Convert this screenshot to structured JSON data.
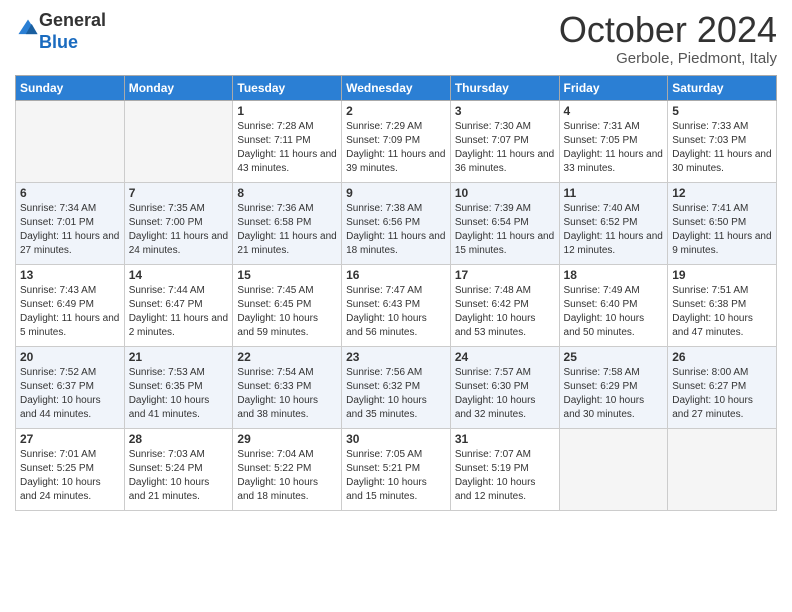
{
  "logo": {
    "general": "General",
    "blue": "Blue"
  },
  "header": {
    "month": "October 2024",
    "location": "Gerbole, Piedmont, Italy"
  },
  "weekdays": [
    "Sunday",
    "Monday",
    "Tuesday",
    "Wednesday",
    "Thursday",
    "Friday",
    "Saturday"
  ],
  "weeks": [
    [
      {
        "day": "",
        "info": ""
      },
      {
        "day": "",
        "info": ""
      },
      {
        "day": "1",
        "info": "Sunrise: 7:28 AM\nSunset: 7:11 PM\nDaylight: 11 hours and 43 minutes."
      },
      {
        "day": "2",
        "info": "Sunrise: 7:29 AM\nSunset: 7:09 PM\nDaylight: 11 hours and 39 minutes."
      },
      {
        "day": "3",
        "info": "Sunrise: 7:30 AM\nSunset: 7:07 PM\nDaylight: 11 hours and 36 minutes."
      },
      {
        "day": "4",
        "info": "Sunrise: 7:31 AM\nSunset: 7:05 PM\nDaylight: 11 hours and 33 minutes."
      },
      {
        "day": "5",
        "info": "Sunrise: 7:33 AM\nSunset: 7:03 PM\nDaylight: 11 hours and 30 minutes."
      }
    ],
    [
      {
        "day": "6",
        "info": "Sunrise: 7:34 AM\nSunset: 7:01 PM\nDaylight: 11 hours and 27 minutes."
      },
      {
        "day": "7",
        "info": "Sunrise: 7:35 AM\nSunset: 7:00 PM\nDaylight: 11 hours and 24 minutes."
      },
      {
        "day": "8",
        "info": "Sunrise: 7:36 AM\nSunset: 6:58 PM\nDaylight: 11 hours and 21 minutes."
      },
      {
        "day": "9",
        "info": "Sunrise: 7:38 AM\nSunset: 6:56 PM\nDaylight: 11 hours and 18 minutes."
      },
      {
        "day": "10",
        "info": "Sunrise: 7:39 AM\nSunset: 6:54 PM\nDaylight: 11 hours and 15 minutes."
      },
      {
        "day": "11",
        "info": "Sunrise: 7:40 AM\nSunset: 6:52 PM\nDaylight: 11 hours and 12 minutes."
      },
      {
        "day": "12",
        "info": "Sunrise: 7:41 AM\nSunset: 6:50 PM\nDaylight: 11 hours and 9 minutes."
      }
    ],
    [
      {
        "day": "13",
        "info": "Sunrise: 7:43 AM\nSunset: 6:49 PM\nDaylight: 11 hours and 5 minutes."
      },
      {
        "day": "14",
        "info": "Sunrise: 7:44 AM\nSunset: 6:47 PM\nDaylight: 11 hours and 2 minutes."
      },
      {
        "day": "15",
        "info": "Sunrise: 7:45 AM\nSunset: 6:45 PM\nDaylight: 10 hours and 59 minutes."
      },
      {
        "day": "16",
        "info": "Sunrise: 7:47 AM\nSunset: 6:43 PM\nDaylight: 10 hours and 56 minutes."
      },
      {
        "day": "17",
        "info": "Sunrise: 7:48 AM\nSunset: 6:42 PM\nDaylight: 10 hours and 53 minutes."
      },
      {
        "day": "18",
        "info": "Sunrise: 7:49 AM\nSunset: 6:40 PM\nDaylight: 10 hours and 50 minutes."
      },
      {
        "day": "19",
        "info": "Sunrise: 7:51 AM\nSunset: 6:38 PM\nDaylight: 10 hours and 47 minutes."
      }
    ],
    [
      {
        "day": "20",
        "info": "Sunrise: 7:52 AM\nSunset: 6:37 PM\nDaylight: 10 hours and 44 minutes."
      },
      {
        "day": "21",
        "info": "Sunrise: 7:53 AM\nSunset: 6:35 PM\nDaylight: 10 hours and 41 minutes."
      },
      {
        "day": "22",
        "info": "Sunrise: 7:54 AM\nSunset: 6:33 PM\nDaylight: 10 hours and 38 minutes."
      },
      {
        "day": "23",
        "info": "Sunrise: 7:56 AM\nSunset: 6:32 PM\nDaylight: 10 hours and 35 minutes."
      },
      {
        "day": "24",
        "info": "Sunrise: 7:57 AM\nSunset: 6:30 PM\nDaylight: 10 hours and 32 minutes."
      },
      {
        "day": "25",
        "info": "Sunrise: 7:58 AM\nSunset: 6:29 PM\nDaylight: 10 hours and 30 minutes."
      },
      {
        "day": "26",
        "info": "Sunrise: 8:00 AM\nSunset: 6:27 PM\nDaylight: 10 hours and 27 minutes."
      }
    ],
    [
      {
        "day": "27",
        "info": "Sunrise: 7:01 AM\nSunset: 5:25 PM\nDaylight: 10 hours and 24 minutes."
      },
      {
        "day": "28",
        "info": "Sunrise: 7:03 AM\nSunset: 5:24 PM\nDaylight: 10 hours and 21 minutes."
      },
      {
        "day": "29",
        "info": "Sunrise: 7:04 AM\nSunset: 5:22 PM\nDaylight: 10 hours and 18 minutes."
      },
      {
        "day": "30",
        "info": "Sunrise: 7:05 AM\nSunset: 5:21 PM\nDaylight: 10 hours and 15 minutes."
      },
      {
        "day": "31",
        "info": "Sunrise: 7:07 AM\nSunset: 5:19 PM\nDaylight: 10 hours and 12 minutes."
      },
      {
        "day": "",
        "info": ""
      },
      {
        "day": "",
        "info": ""
      }
    ]
  ]
}
